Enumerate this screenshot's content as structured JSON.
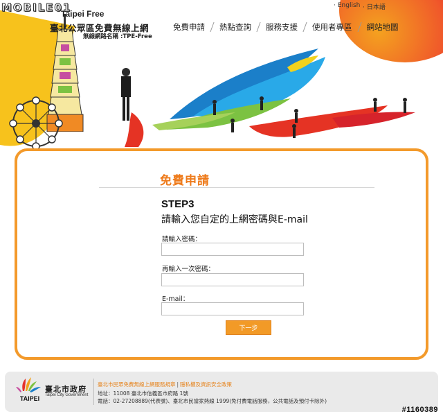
{
  "watermark": "MOBILE01",
  "brand": {
    "title_small": "Taipei Free",
    "title": "臺北公眾區免費無線上網",
    "ssid": "無線網路名稱 :TPE-Free"
  },
  "languages": [
    "English",
    "日本語"
  ],
  "nav": [
    "免費申請",
    "熱點查詢",
    "服務支援",
    "使用者專區",
    "網站地圖"
  ],
  "form": {
    "title": "免費申請",
    "step": "STEP3",
    "description": "請輸入您自定的上網密碼與E-mail",
    "fields": [
      {
        "label": "請輸入密碼：",
        "value": ""
      },
      {
        "label": "再輸入一次密碼：",
        "value": ""
      },
      {
        "label": "E-mail：",
        "value": ""
      }
    ],
    "submit_label": "下一步"
  },
  "footer": {
    "gov_name": "臺北市政府",
    "gov_name_en": "Taipei City Government",
    "logo_text": "TAIPEI",
    "links": [
      "臺北市民眾免費無線上網服務規章",
      "隱私權及資訊安全政策"
    ],
    "address": "地址：11008 臺北市信義區市府路 1號",
    "phone": "電話：02-27208889(代表號)、臺北市民當家熱線 1999(免付費電話服務，公共電話及預付卡除外)"
  },
  "image_id": "#1160389",
  "colors": {
    "accent": "#f39a2b",
    "title": "#ee7a1a",
    "button": "#f29a27"
  }
}
